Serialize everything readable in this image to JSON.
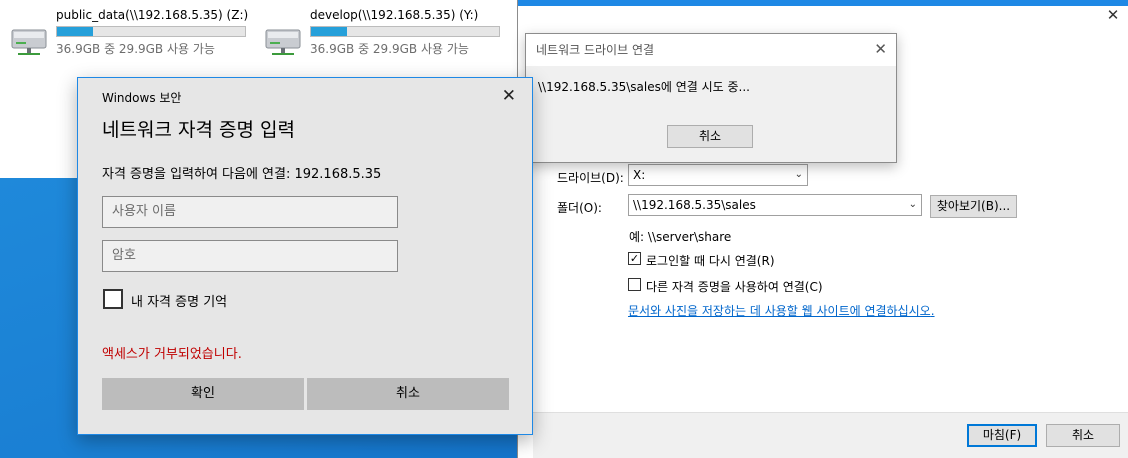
{
  "drives": [
    {
      "name": "public_data(\\\\192.168.5.35) (Z:)",
      "info": "36.9GB 중 29.9GB 사용 가능",
      "used_fraction": 0.19
    },
    {
      "name": "develop(\\\\192.168.5.35) (Y:)",
      "info": "36.9GB 중 29.9GB 사용 가능",
      "used_fraction": 0.19
    }
  ],
  "wizard": {
    "drive_label": "드라이브(D):",
    "drive_value": "X:",
    "folder_label": "폴더(O):",
    "folder_value": "\\\\192.168.5.35\\sales",
    "browse_label": "찾아보기(B)...",
    "example": "예: \\\\server\\share",
    "reconnect_label": "로그인할 때 다시 연결(R)",
    "reconnect_checked": true,
    "other_creds_label": "다른 자격 증명을 사용하여 연결(C)",
    "other_creds_checked": false,
    "link": "문서와 사진을 저장하는 데 사용할 웹 사이트에 연결하십시오",
    "finish_label": "마침(F)",
    "cancel_label": "취소"
  },
  "connecting": {
    "title": "네트워크 드라이브 연결",
    "message": "\\\\192.168.5.35\\sales에 연결 시도 중...",
    "cancel_label": "취소"
  },
  "credentials": {
    "caption": "Windows 보안",
    "title": "네트워크 자격 증명 입력",
    "subtitle": "자격 증명을 입력하여 다음에 연결: 192.168.5.35",
    "username_placeholder": "사용자 이름",
    "password_placeholder": "암호",
    "remember_label": "내 자격 증명 기억",
    "remember_checked": false,
    "error": "액세스가 거부되었습니다.",
    "ok_label": "확인",
    "cancel_label": "취소"
  },
  "colors": {
    "accent": "#1e88e5",
    "error": "#c00000",
    "progress": "#26a0da"
  }
}
